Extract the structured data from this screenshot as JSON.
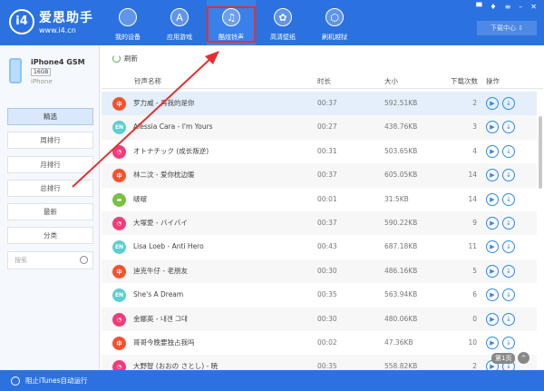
{
  "app": {
    "name": "爱思助手",
    "url": "www.i4.cn",
    "logo_text": "i4"
  },
  "nav": [
    {
      "label": "我的设备",
      "icon": ""
    },
    {
      "label": "应用游戏",
      "icon": "A"
    },
    {
      "label": "酷炫铃声",
      "icon": "♫"
    },
    {
      "label": "高清壁纸",
      "icon": "✿"
    },
    {
      "label": "刷机越狱",
      "icon": "⬡"
    }
  ],
  "window_controls": [
    "▀",
    "♦",
    "≡",
    "–",
    "✕"
  ],
  "download_center": "下载中心 ⇩",
  "device": {
    "name": "iPhone4 GSM",
    "capacity": "16GB",
    "type": "iPhone"
  },
  "sidebar": {
    "items": [
      "精选",
      "周排行",
      "月排行",
      "总排行",
      "最新",
      "分类"
    ],
    "search_placeholder": "搜索"
  },
  "toolbar": {
    "refresh": "刷新"
  },
  "table": {
    "headers": [
      "铃声名称",
      "时长",
      "大小",
      "下载次数",
      "操作"
    ],
    "rows": [
      {
        "badge": "中",
        "color": "#f4522d",
        "name": "罗力威 - 再我的是你",
        "duration": "00:37",
        "size": "592.51KB",
        "downloads": "2"
      },
      {
        "badge": "EN",
        "color": "#5ecfcf",
        "name": "Alessia Cara - I'm Yours",
        "duration": "00:27",
        "size": "438.76KB",
        "downloads": "3"
      },
      {
        "badge": "◔",
        "color": "#ef3d7a",
        "name": "オトナチック (成长叛逆)",
        "duration": "00:31",
        "size": "503.65KB",
        "downloads": "4"
      },
      {
        "badge": "中",
        "color": "#f4522d",
        "name": "林二汶 - 爱你枕边暖",
        "duration": "00:37",
        "size": "605.05KB",
        "downloads": "14"
      },
      {
        "badge": "▬",
        "color": "#7bc043",
        "name": "啵啵",
        "duration": "00:01",
        "size": "31.5KB",
        "downloads": "14"
      },
      {
        "badge": "◔",
        "color": "#ef3d7a",
        "name": "大塚愛 - バイバイ",
        "duration": "00:37",
        "size": "590.22KB",
        "downloads": "9"
      },
      {
        "badge": "EN",
        "color": "#5ecfcf",
        "name": "Lisa Loeb - Anti Hero",
        "duration": "00:43",
        "size": "687.18KB",
        "downloads": "11"
      },
      {
        "badge": "中",
        "color": "#f4522d",
        "name": "迪克牛仔 - 老朋友",
        "duration": "00:30",
        "size": "486.16KB",
        "downloads": "5"
      },
      {
        "badge": "EN",
        "color": "#5ecfcf",
        "name": "She's A Dream",
        "duration": "00:35",
        "size": "563.94KB",
        "downloads": "6"
      },
      {
        "badge": "◔",
        "color": "#ef3d7a",
        "name": "金娜英 - 내겐 그대",
        "duration": "00:30",
        "size": "480.06KB",
        "downloads": "0"
      },
      {
        "badge": "中",
        "color": "#f4522d",
        "name": "哥哥今晚要独占我吗",
        "duration": "00:02",
        "size": "47.36KB",
        "downloads": "10"
      },
      {
        "badge": "◔",
        "color": "#ef3d7a",
        "name": "大野智 (おおの さとし) - 暁",
        "duration": "00:35",
        "size": "558.82KB",
        "downloads": "2"
      }
    ]
  },
  "pager": {
    "page": "第1页",
    "up": "^"
  },
  "footer": {
    "itunes": "阻止iTunes自动运行"
  }
}
